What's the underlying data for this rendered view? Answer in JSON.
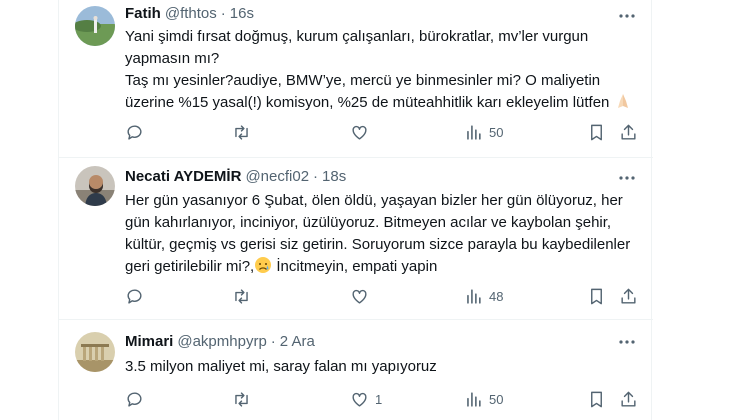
{
  "tweets": [
    {
      "name": "Fatih",
      "handle": "@fthtos",
      "separator": "·",
      "time": "16s",
      "lines": [
        "Yani şimdi fırsat doğmuş, kurum çalışanları, bürokratlar, mv’ler vurgun",
        "yapmasın mı?",
        "Taş mı yesinler?audiye, BMW’ye, mercü ye binmesinler mi? O maliyetin",
        "üzerine %15 yasal(!) komisyon, %25 de müteahhitlik karı ekleyelim lütfen"
      ],
      "emoji": "folded-hands",
      "reply_count": "",
      "retweet_count": "",
      "like_count": "",
      "views": "50"
    },
    {
      "name": "Necati AYDEMİR",
      "handle": "@necfi02",
      "separator": "·",
      "time": "18s",
      "lines": [
        "Her gün yasanıyor 6 Şubat, ölen öldü, yaşayan bizler her gün ölüyoruz, her",
        "gün kahırlanıyor, inciniyor, üzülüyoruz. Bitmeyen acılar ve kaybolan şehir,",
        "kültür, geçmiş vs gerisi siz getirin. Soruyorum sizce parayla bu kaybedilenler",
        "geri getirilebilir mi?,",
        " İncitmeyin, empati yapin"
      ],
      "emoji": "sad-face",
      "reply_count": "",
      "retweet_count": "",
      "like_count": "",
      "views": "48"
    },
    {
      "name": "Mimari",
      "handle": "@akpmhpyrp",
      "separator": "·",
      "time": "2 Ara",
      "lines": [
        "3.5 milyon maliyet mi, saray falan mı yapıyoruz"
      ],
      "reply_count": "",
      "retweet_count": "",
      "like_count": "1",
      "views": "50"
    }
  ],
  "colors": {
    "text": "#0f1419",
    "muted": "#536471",
    "border": "#eff3f4"
  },
  "icons": [
    "more-icon",
    "reply-icon",
    "retweet-icon",
    "like-icon",
    "views-icon",
    "bookmark-icon",
    "share-icon"
  ]
}
